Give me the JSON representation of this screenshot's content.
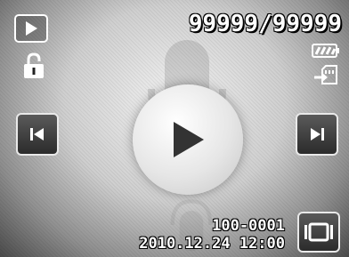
{
  "status": {
    "counter": "99999/99999",
    "file_number": "100-0001",
    "datetime": "2010.12.24  12:00"
  },
  "icons": {
    "mode": "playback-mode-icon",
    "lock": "unlocked-padlock-icon",
    "battery": "battery-full-icon",
    "storage": "memory-card-icon",
    "prev": "previous-track-icon",
    "next": "next-track-icon",
    "play": "play-icon",
    "movie": "slideshow-icon"
  },
  "colors": {
    "button_bg": "#3a3a3a",
    "button_border": "#e9e9e9",
    "text": "#ffffff"
  }
}
